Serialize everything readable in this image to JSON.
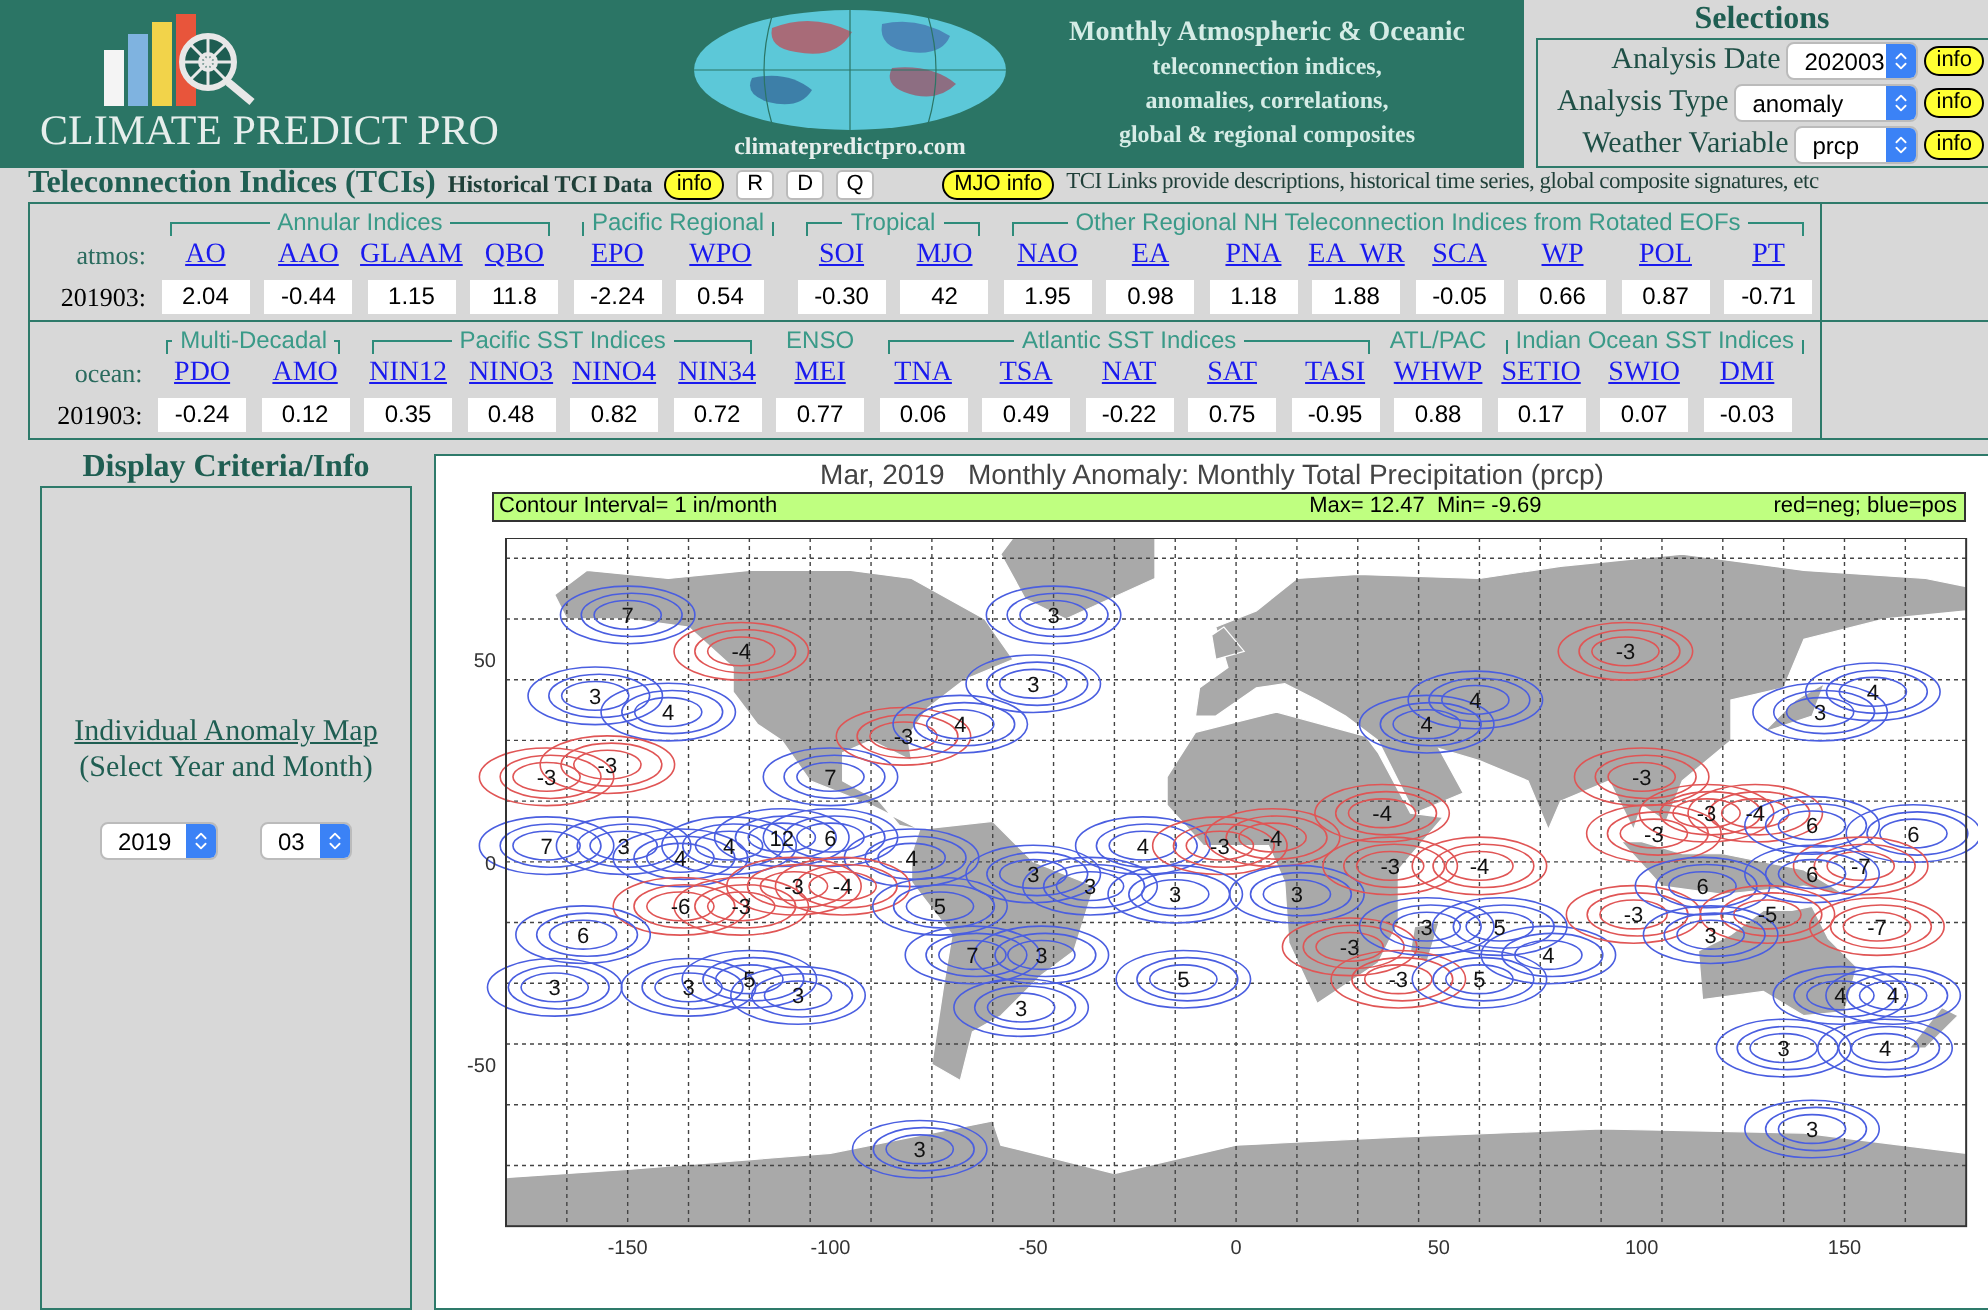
{
  "header": {
    "brand": "CLIMATE PREDICT PRO",
    "site": "climatepredictpro.com",
    "tagline": [
      "Monthly Atmospheric & Oceanic",
      "teleconnection indices,",
      "anomalies, correlations,",
      "global & regional composites"
    ]
  },
  "selections": {
    "title": "Selections",
    "rows": [
      {
        "label": "Analysis Date",
        "value": "202003",
        "info": "info"
      },
      {
        "label": "Analysis Type",
        "value": "anomaly",
        "info": "info"
      },
      {
        "label": "Weather Variable",
        "value": "prcp",
        "info": "info"
      }
    ]
  },
  "tci_bar": {
    "title": "Teleconnection Indices (TCIs)",
    "historical": "Historical TCI Data",
    "info": "info",
    "buttons": [
      "R",
      "D",
      "Q"
    ],
    "mjo_info": "MJO info",
    "note": "TCI Links provide descriptions, historical time series, global composite signatures, etc"
  },
  "tci_rows": [
    {
      "label": "atmos:",
      "date": "201903:",
      "groups": [
        {
          "title": "Annular Indices",
          "bracket": true,
          "indices": [
            {
              "name": "AO",
              "value": "2.04"
            },
            {
              "name": "AAO",
              "value": "-0.44"
            },
            {
              "name": "GLAAM",
              "value": "1.15"
            },
            {
              "name": "QBO",
              "value": "11.8"
            }
          ]
        },
        {
          "title": "Pacific Regional",
          "bracket": true,
          "indices": [
            {
              "name": "EPO",
              "value": "-2.24"
            },
            {
              "name": "WPO",
              "value": "0.54"
            }
          ]
        },
        {
          "title": "Tropical",
          "bracket": true,
          "indices": [
            {
              "name": "SOI",
              "value": "-0.30"
            },
            {
              "name": "MJO",
              "value": "42"
            }
          ]
        },
        {
          "title": "Other Regional NH Teleconnection Indices from Rotated EOFs",
          "bracket": true,
          "indices": [
            {
              "name": "NAO",
              "value": "1.95"
            },
            {
              "name": "EA",
              "value": "0.98"
            },
            {
              "name": "PNA",
              "value": "1.18"
            },
            {
              "name": "EA_WR",
              "value": "1.88"
            },
            {
              "name": "SCA",
              "value": "-0.05"
            },
            {
              "name": "WP",
              "value": "0.66"
            },
            {
              "name": "POL",
              "value": "0.87"
            },
            {
              "name": "PT",
              "value": "-0.71"
            }
          ]
        }
      ]
    },
    {
      "label": "ocean:",
      "date": "201903:",
      "groups": [
        {
          "title": "Multi-Decadal",
          "bracket": true,
          "indices": [
            {
              "name": "PDO",
              "value": "-0.24"
            },
            {
              "name": "AMO",
              "value": "0.12"
            }
          ]
        },
        {
          "title": "Pacific SST Indices",
          "bracket": true,
          "indices": [
            {
              "name": "NIN12",
              "value": "0.35"
            },
            {
              "name": "NINO3",
              "value": "0.48"
            },
            {
              "name": "NINO4",
              "value": "0.82"
            },
            {
              "name": "NIN34",
              "value": "0.72"
            }
          ]
        },
        {
          "title": "ENSO",
          "bracket": false,
          "indices": [
            {
              "name": "MEI",
              "value": "0.77"
            }
          ]
        },
        {
          "title": "Atlantic SST Indices",
          "bracket": true,
          "indices": [
            {
              "name": "TNA",
              "value": "0.06"
            },
            {
              "name": "TSA",
              "value": "0.49"
            },
            {
              "name": "NAT",
              "value": "-0.22"
            },
            {
              "name": "SAT",
              "value": "0.75"
            },
            {
              "name": "TASI",
              "value": "-0.95"
            }
          ]
        },
        {
          "title": "ATL/PAC",
          "bracket": false,
          "indices": [
            {
              "name": "WHWP",
              "value": "0.88"
            }
          ]
        },
        {
          "title": "Indian Ocean SST Indices",
          "bracket": true,
          "indices": [
            {
              "name": "SETIO",
              "value": "0.17"
            },
            {
              "name": "SWIO",
              "value": "0.07"
            },
            {
              "name": "DMI",
              "value": "-0.03"
            }
          ]
        }
      ]
    }
  ],
  "display": {
    "title": "Display Criteria/Info",
    "link": "Individual Anomaly Map",
    "hint": "(Select Year and Month)",
    "year": "2019",
    "month": "03"
  },
  "map": {
    "title": "Mar, 2019   Monthly Anomaly: Monthly Total Precipitation (prcp)",
    "interval": "Contour Interval= 1 in/month",
    "range": "Max= 12.47  Min= -9.69",
    "legend": "red=neg; blue=pos",
    "yticks": [
      "50",
      "0",
      "-50"
    ],
    "xticks": [
      "-150",
      "-100",
      "-50",
      "0",
      "50",
      "100",
      "150"
    ],
    "contour_labels": [
      {
        "text": "7",
        "kind": "positive"
      },
      {
        "text": "-4",
        "kind": "negative"
      },
      {
        "text": "3",
        "kind": "positive"
      },
      {
        "text": "4",
        "kind": "positive"
      },
      {
        "text": "-3",
        "kind": "negative"
      },
      {
        "text": "-3",
        "kind": "negative"
      },
      {
        "text": "7",
        "kind": "positive"
      },
      {
        "text": "-3",
        "kind": "negative"
      },
      {
        "text": "4",
        "kind": "positive"
      },
      {
        "text": "3",
        "kind": "positive"
      },
      {
        "text": "3",
        "kind": "positive"
      },
      {
        "text": "7",
        "kind": "positive"
      },
      {
        "text": "3",
        "kind": "positive"
      },
      {
        "text": "4",
        "kind": "positive"
      },
      {
        "text": "4",
        "kind": "positive"
      },
      {
        "text": "12",
        "kind": "positive"
      },
      {
        "text": "6",
        "kind": "positive"
      },
      {
        "text": "4",
        "kind": "positive"
      },
      {
        "text": "-3",
        "kind": "negative"
      },
      {
        "text": "-4",
        "kind": "negative"
      },
      {
        "text": "-6",
        "kind": "negative"
      },
      {
        "text": "-3",
        "kind": "negative"
      },
      {
        "text": "6",
        "kind": "positive"
      },
      {
        "text": "3",
        "kind": "positive"
      },
      {
        "text": "3",
        "kind": "positive"
      },
      {
        "text": "5",
        "kind": "positive"
      },
      {
        "text": "3",
        "kind": "positive"
      },
      {
        "text": "5",
        "kind": "positive"
      },
      {
        "text": "7",
        "kind": "positive"
      },
      {
        "text": "3",
        "kind": "positive"
      },
      {
        "text": "3",
        "kind": "positive"
      },
      {
        "text": "3",
        "kind": "positive"
      },
      {
        "text": "3",
        "kind": "positive"
      },
      {
        "text": "3",
        "kind": "positive"
      },
      {
        "text": "4",
        "kind": "positive"
      },
      {
        "text": "-3",
        "kind": "negative"
      },
      {
        "text": "-4",
        "kind": "negative"
      },
      {
        "text": "3",
        "kind": "positive"
      },
      {
        "text": "5",
        "kind": "positive"
      },
      {
        "text": "3",
        "kind": "positive"
      },
      {
        "text": "-4",
        "kind": "negative"
      },
      {
        "text": "-3",
        "kind": "negative"
      },
      {
        "text": "-3",
        "kind": "negative"
      },
      {
        "text": "3",
        "kind": "positive"
      },
      {
        "text": "-3",
        "kind": "negative"
      },
      {
        "text": "5",
        "kind": "positive"
      },
      {
        "text": "5",
        "kind": "positive"
      },
      {
        "text": "4",
        "kind": "positive"
      },
      {
        "text": "-4",
        "kind": "negative"
      },
      {
        "text": "4",
        "kind": "positive"
      },
      {
        "text": "4",
        "kind": "positive"
      },
      {
        "text": "-3",
        "kind": "negative"
      },
      {
        "text": "-3",
        "kind": "negative"
      },
      {
        "text": "-3",
        "kind": "negative"
      },
      {
        "text": "-3",
        "kind": "negative"
      },
      {
        "text": "-4",
        "kind": "negative"
      },
      {
        "text": "-3",
        "kind": "negative"
      },
      {
        "text": "3",
        "kind": "positive"
      },
      {
        "text": "4",
        "kind": "positive"
      },
      {
        "text": "6",
        "kind": "positive"
      },
      {
        "text": "6",
        "kind": "positive"
      },
      {
        "text": "-7",
        "kind": "negative"
      },
      {
        "text": "6",
        "kind": "positive"
      },
      {
        "text": "6",
        "kind": "positive"
      },
      {
        "text": "-5",
        "kind": "negative"
      },
      {
        "text": "3",
        "kind": "positive"
      },
      {
        "text": "-7",
        "kind": "negative"
      },
      {
        "text": "4",
        "kind": "positive"
      },
      {
        "text": "4",
        "kind": "positive"
      },
      {
        "text": "3",
        "kind": "positive"
      },
      {
        "text": "4",
        "kind": "positive"
      },
      {
        "text": "3",
        "kind": "positive"
      }
    ]
  }
}
